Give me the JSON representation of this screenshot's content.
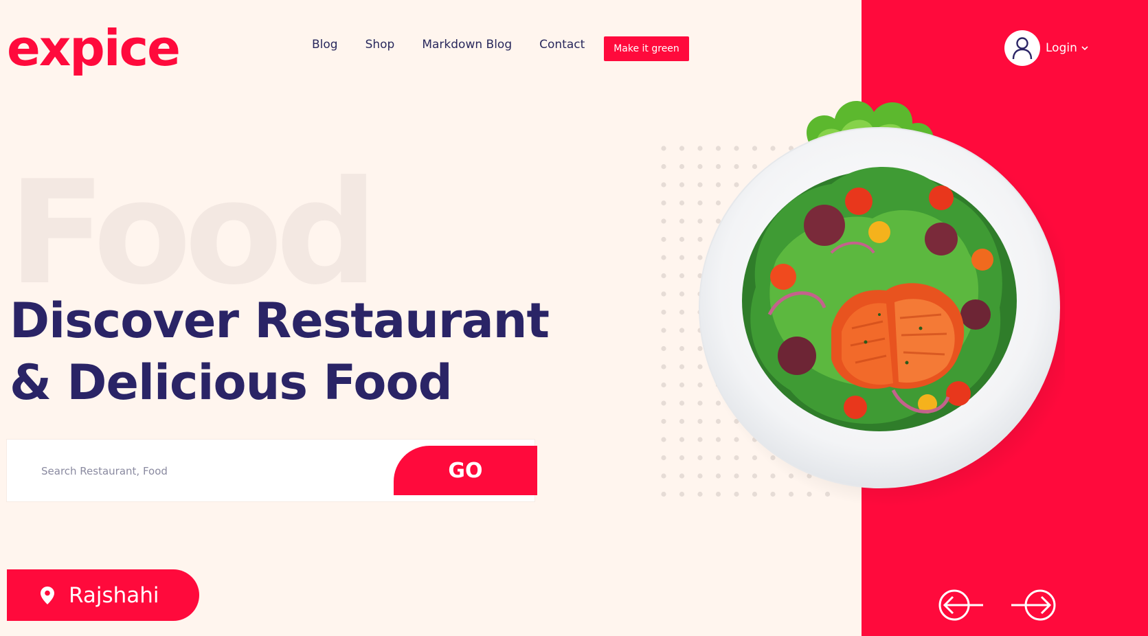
{
  "brand": {
    "logo_text": "expice"
  },
  "nav": {
    "items": [
      {
        "label": "Blog"
      },
      {
        "label": "Shop"
      },
      {
        "label": "Markdown Blog"
      },
      {
        "label": "Contact"
      }
    ],
    "cta_label": "Make it green"
  },
  "user_menu": {
    "label": "Login",
    "avatar_icon": "user-icon",
    "dropdown_icon": "chevron-down-icon"
  },
  "hero": {
    "background_word": "Food",
    "headline_line1": "Discover Restaurant",
    "headline_line2": "& Delicious Food"
  },
  "search": {
    "placeholder": "Search Restaurant, Food",
    "value": "",
    "button_label": "GO"
  },
  "location": {
    "label": "Rajshahi",
    "icon": "map-pin-icon"
  },
  "carousel": {
    "prev_icon": "arrow-left-icon",
    "next_icon": "arrow-right-icon"
  },
  "colors": {
    "accent": "#ff0a3c",
    "heading": "#2a2466",
    "background": "#fff5ee",
    "nav_text": "#28285c"
  }
}
